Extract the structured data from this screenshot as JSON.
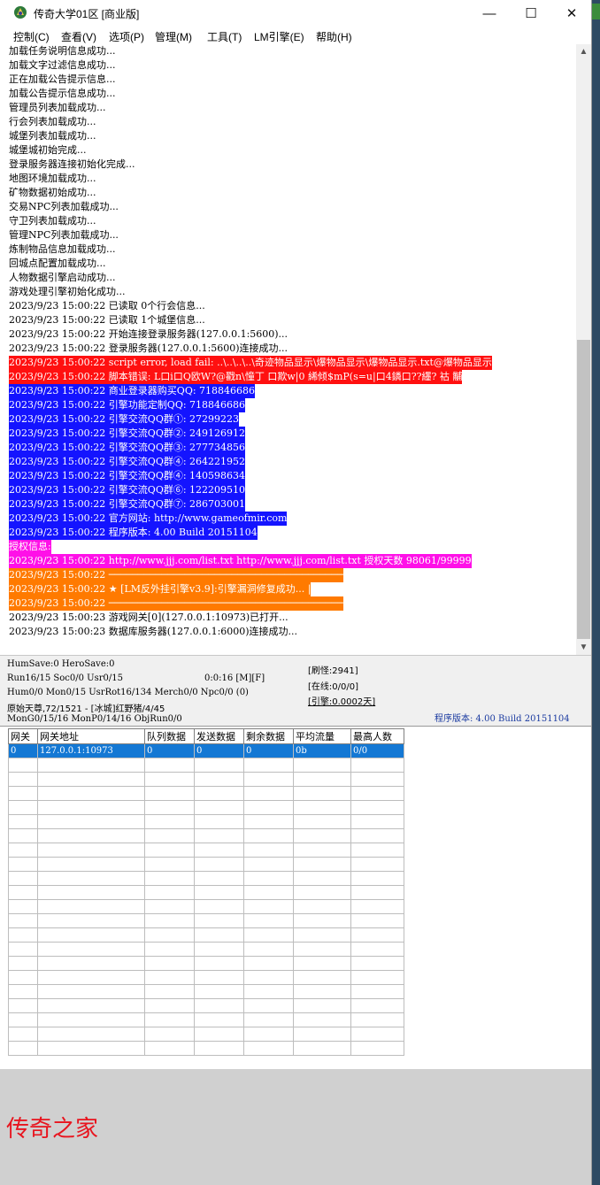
{
  "window": {
    "title": "传奇大学01区 [商业版]"
  },
  "titlebar_buttons": {
    "minimize": "—",
    "maximize": "☐",
    "close": "✕"
  },
  "menu": [
    "控制(C)",
    "查看(V)",
    "选项(P)",
    "管理(M)",
    "工具(T)",
    "LM引擎(E)",
    "帮助(H)"
  ],
  "log": [
    {
      "text": "加载任务说明信息成功...",
      "style": "normal"
    },
    {
      "text": "加载文字过滤信息成功...",
      "style": "normal"
    },
    {
      "text": "正在加载公告提示信息...",
      "style": "normal"
    },
    {
      "text": "加载公告提示信息成功...",
      "style": "normal"
    },
    {
      "text": "管理员列表加载成功...",
      "style": "normal"
    },
    {
      "text": "行会列表加载成功...",
      "style": "normal"
    },
    {
      "text": "城堡列表加载成功...",
      "style": "normal"
    },
    {
      "text": "城堡城初始完成...",
      "style": "normal"
    },
    {
      "text": "登录服务器连接初始化完成...",
      "style": "normal"
    },
    {
      "text": "地图环境加载成功...",
      "style": "normal"
    },
    {
      "text": "矿物数据初始成功...",
      "style": "normal"
    },
    {
      "text": "交易NPC列表加载成功...",
      "style": "normal"
    },
    {
      "text": "守卫列表加载成功...",
      "style": "normal"
    },
    {
      "text": "管理NPC列表加载成功...",
      "style": "normal"
    },
    {
      "text": "炼制物品信息加载成功...",
      "style": "normal"
    },
    {
      "text": "回城点配置加载成功...",
      "style": "normal"
    },
    {
      "text": "人物数据引擎启动成功...",
      "style": "normal"
    },
    {
      "text": "游戏处理引擎初始化成功...",
      "style": "normal"
    },
    {
      "text": "2023/9/23 15:00:22 已读取 0个行会信息...",
      "style": "normal"
    },
    {
      "text": "2023/9/23 15:00:22 已读取 1个城堡信息...",
      "style": "normal"
    },
    {
      "text": "2023/9/23 15:00:22 开始连接登录服务器(127.0.0.1:5600)...",
      "style": "normal"
    },
    {
      "text": "2023/9/23 15:00:22 登录服务器(127.0.0.1:5600)连接成功...",
      "style": "normal"
    },
    {
      "text": "2023/9/23 15:00:22 script error, load fail: ..\\..\\..\\..\\奇迹物品显示\\爆物品显示\\爆物品显示.txt@爆物品显示",
      "style": "red"
    },
    {
      "text": "2023/9/23 15:00:22 脚本错误: L口i口Q欧W?@戳n\\憧丁  口欺w|0  絺倾$mP(s=u|口4鏻口??纆?  祜       黼",
      "style": "red"
    },
    {
      "text": "2023/9/23 15:00:22 商业登录器购买QQ: 718846686",
      "style": "blue"
    },
    {
      "text": "2023/9/23 15:00:22 引擎功能定制QQ: 718846686",
      "style": "blue"
    },
    {
      "text": "2023/9/23 15:00:22 引擎交流QQ群①: 27299223",
      "style": "blue"
    },
    {
      "text": "2023/9/23 15:00:22 引擎交流QQ群②: 249126912",
      "style": "blue"
    },
    {
      "text": "2023/9/23 15:00:22 引擎交流QQ群③: 277734856",
      "style": "blue"
    },
    {
      "text": "2023/9/23 15:00:22 引擎交流QQ群④: 264221952",
      "style": "blue"
    },
    {
      "text": "2023/9/23 15:00:22 引擎交流QQ群④: 140598634",
      "style": "blue"
    },
    {
      "text": "2023/9/23 15:00:22 引擎交流QQ群⑥: 122209510",
      "style": "blue"
    },
    {
      "text": "2023/9/23 15:00:22 引擎交流QQ群⑦: 286703001",
      "style": "blue"
    },
    {
      "text": "2023/9/23 15:00:22 官方网站: http://www.gameofmir.com",
      "style": "blue"
    },
    {
      "text": "2023/9/23 15:00:22 程序版本: 4.00 Build 20151104",
      "style": "blue"
    },
    {
      "text": "授权信息:",
      "style": "mag"
    },
    {
      "text": "2023/9/23 15:00:22 http://www.jjj.com/list.txt http://www.jjj.com/list.txt 授权天数 98061/99999",
      "style": "mag"
    },
    {
      "text": "2023/9/23 15:00:22 ────────────────────────────────────────",
      "style": "org"
    },
    {
      "text": "2023/9/23 15:00:22 ★ [LM反外挂引擎v3.9]:引擎漏洞修复成功...  |",
      "style": "org"
    },
    {
      "text": "2023/9/23 15:00:22 ────────────────────────────────────────",
      "style": "org"
    },
    {
      "text": "2023/9/23 15:00:23 游戏网关[0](127.0.0.1:10973)已打开...",
      "style": "normal"
    },
    {
      "text": "2023/9/23 15:00:23 数据库服务器(127.0.0.1:6000)连接成功...",
      "style": "normal"
    }
  ],
  "status": {
    "line1": "HumSave:0 HeroSave:0",
    "line2": "Run16/15 Soc0/0 Usr0/15",
    "time": "0:0:16 [M][F]",
    "line3": "Hum0/0 Mon0/15 UsrRot16/134 Merch0/0 Npc0/0 (0)",
    "line4": "原始天尊,72/1521 - [冰城]红野猪/4/45",
    "line5": "MonG0/15/16 MonP0/14/16 ObjRun0/0",
    "refresh": "[刷怪:2941]",
    "online": "[在线:0/0/0]",
    "engine": "[引擎:0.0002天]",
    "version": "程序版本: 4.00 Build 20151104"
  },
  "grid": {
    "headers": [
      "网关",
      "网关地址",
      "队列数据",
      "发送数据",
      "剩余数据",
      "平均流量",
      "最高人数"
    ],
    "rows": [
      [
        "0",
        "127.0.0.1:10973",
        "0",
        "0",
        "0",
        "0b",
        "0/0"
      ]
    ],
    "empty_rows": 21
  },
  "watermark": "传奇之家",
  "colors": {
    "red": "#ff1010",
    "blue": "#1414ff",
    "magenta": "#ff10e8",
    "orange": "#ff7a00",
    "selected_row": "#1478d4"
  },
  "icons": {
    "app": "app-icon",
    "scroll_up": "chevron-up-icon",
    "scroll_down": "chevron-down-icon"
  }
}
